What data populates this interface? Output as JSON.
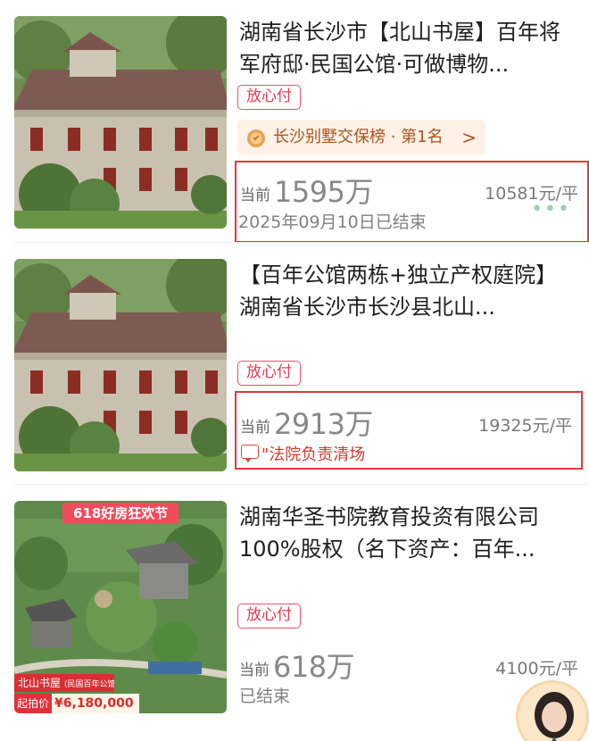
{
  "listings": [
    {
      "title": "湖南省长沙市【北山书屋】百年将军府邸·民国公馆·可做博物...",
      "badge": "放心付",
      "rank_text": "长沙别墅交保榜 · 第1名",
      "rank_chevron": ">",
      "price_prefix": "当前",
      "price": "1595万",
      "unit_price": "10581元/平",
      "status": "2025年09月10日已结束",
      "more": "•••"
    },
    {
      "title": "【百年公馆两栋+独立产权庭院】湖南省长沙市长沙县北山...",
      "badge": "放心付",
      "price_prefix": "当前",
      "price": "2913万",
      "unit_price": "19325元/平",
      "note": "\"法院负责清场"
    },
    {
      "title": "湖南华圣书院教育投资有限公司100%股权（名下资产：百年...",
      "badge": "放心付",
      "price_prefix": "当前",
      "price": "618万",
      "unit_price": "4100元/平",
      "status": "已结束",
      "promo_tag": "618好房狂欢节",
      "overlay_name": "北山书屋",
      "overlay_name_sub": "(民国百年公馆)",
      "overlay_start_label": "起拍价",
      "overlay_price": "¥6,180,000"
    }
  ],
  "colors": {
    "accent_red": "#e23a3a",
    "badge_pink": "#ec4f68",
    "rank_bg": "#fff1e6",
    "rank_text": "#a8551f"
  }
}
